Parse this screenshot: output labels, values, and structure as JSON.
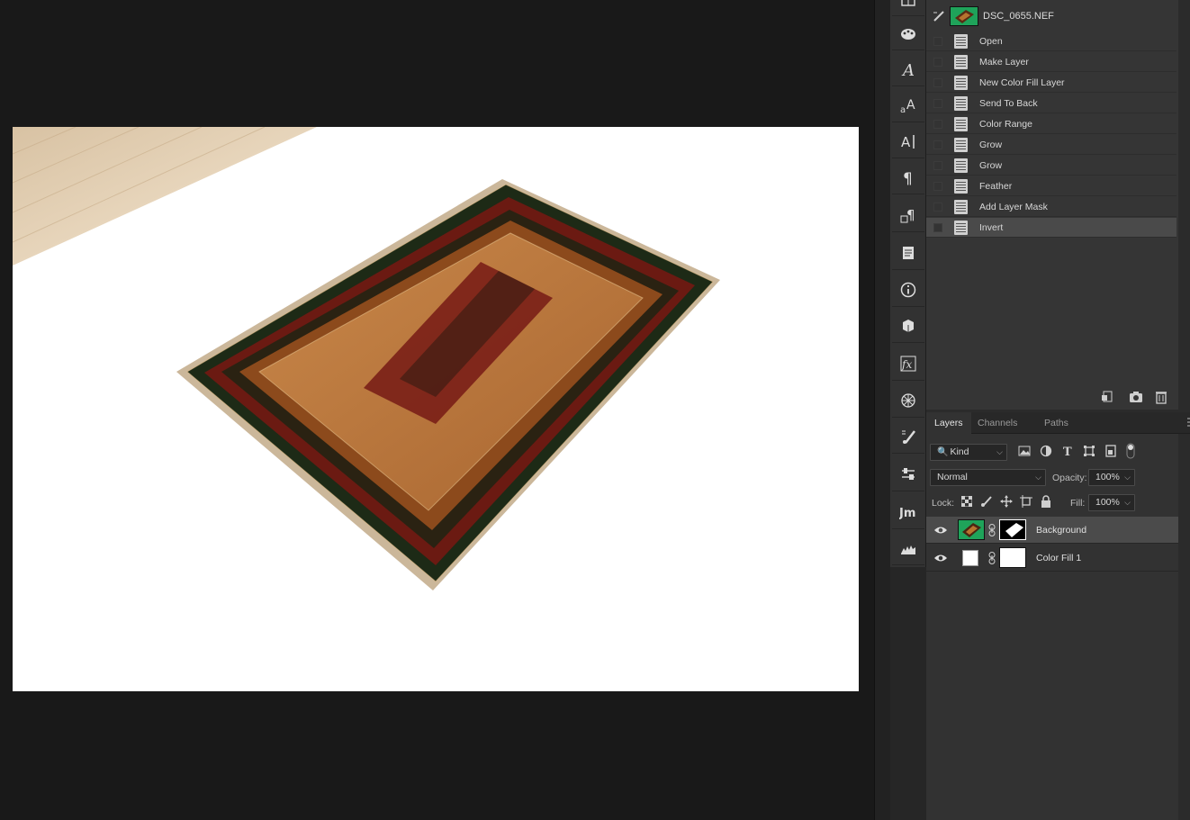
{
  "document": {
    "filename": "DSC_0655.NEF"
  },
  "history": {
    "snapshot_label": "DSC_0655.NEF",
    "items": [
      {
        "label": "Open"
      },
      {
        "label": "Make Layer"
      },
      {
        "label": "New Color Fill Layer"
      },
      {
        "label": "Send To Back"
      },
      {
        "label": "Color Range"
      },
      {
        "label": "Grow"
      },
      {
        "label": "Grow"
      },
      {
        "label": "Feather"
      },
      {
        "label": "Add Layer Mask"
      },
      {
        "label": "Invert"
      }
    ],
    "active_item": "Invert"
  },
  "tools": [
    "grid-icon",
    "palette-icon",
    "character-style-icon",
    "glyphs-icon",
    "type-icon",
    "paragraph-icon",
    "paragraph-style-icon",
    "notes-icon",
    "info-icon",
    "3d-icon",
    "fx-icon",
    "adjustments-icon",
    "brush-settings-icon",
    "properties-icon",
    "jm-plugin-icon",
    "histogram-icon"
  ],
  "layers_panel": {
    "tabs": [
      "Layers",
      "Channels",
      "Paths"
    ],
    "active_tab": "Layers",
    "filter_label": "Kind",
    "blend_mode": "Normal",
    "opacity_label": "Opacity:",
    "opacity_value": "100%",
    "lock_label": "Lock:",
    "fill_label": "Fill:",
    "fill_value": "100%",
    "layers": [
      {
        "name": "Background",
        "selected": true,
        "visible": true
      },
      {
        "name": "Color Fill 1",
        "selected": false,
        "visible": true
      }
    ]
  },
  "colors": {
    "accent_green": "#1fa35a",
    "panel_bg": "#323232",
    "canvas_bg": "#191919"
  }
}
